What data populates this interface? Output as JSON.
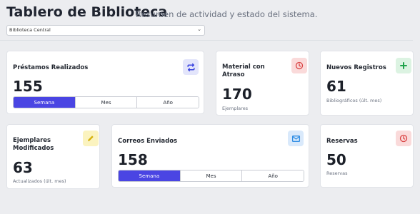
{
  "header": {
    "title": "Tablero de Biblioteca",
    "subtitle": "Resumen de actividad y estado del sistema."
  },
  "branch_select": {
    "value": "Biblioteca Central"
  },
  "cards": {
    "loans": {
      "title": "Préstamos Realizados",
      "value": "155",
      "icon": "repeat-icon",
      "periods": [
        "Semana",
        "Mes",
        "Año"
      ],
      "active_period": "Semana"
    },
    "overdue": {
      "title": "Material con Atraso",
      "value": "170",
      "sub": "Ejemplares",
      "icon": "clock-icon"
    },
    "new_records": {
      "title": "Nuevos Registros",
      "value": "61",
      "sub": "Bibliográficos (últ. mes)",
      "icon": "plus-icon"
    },
    "modified": {
      "title": "Ejemplares Modificados",
      "value": "63",
      "sub": "Actualizados (últ. mes)",
      "icon": "pencil-icon"
    },
    "emails": {
      "title": "Correos Enviados",
      "value": "158",
      "icon": "envelope-icon",
      "periods": [
        "Semana",
        "Mes",
        "Año"
      ],
      "active_period": "Semana"
    },
    "reservations": {
      "title": "Reservas",
      "value": "50",
      "sub": "Reservas",
      "icon": "clock-icon"
    }
  },
  "colors": {
    "accent": "#4a45e3",
    "background": "#ecedf0"
  }
}
